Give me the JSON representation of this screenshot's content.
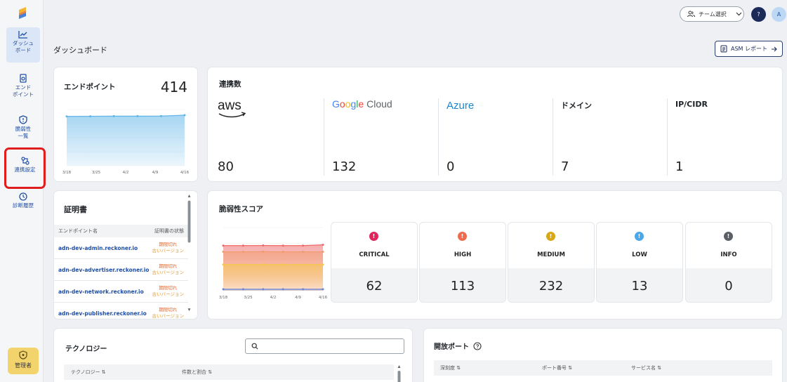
{
  "sidebar": {
    "items": [
      {
        "label_1": "ダッシュ",
        "label_2": "ボード",
        "icon": "chart-line-icon"
      },
      {
        "label_1": "エンド",
        "label_2": "ポイント",
        "icon": "endpoint-icon"
      },
      {
        "label_1": "脆弱性",
        "label_2": "一覧",
        "icon": "shield-icon"
      },
      {
        "label_1": "連携設定",
        "icon": "integration-icon"
      },
      {
        "label_1": "診断履歴",
        "icon": "history-icon"
      }
    ],
    "admin_label": "管理者"
  },
  "header": {
    "team_select": "チーム選択",
    "help": "?",
    "avatar": "A"
  },
  "page": {
    "title": "ダッシュボード",
    "asm_report": "ASM レポート"
  },
  "endpoint": {
    "title": "エンドポイント",
    "count": "414",
    "chart_data": {
      "type": "area",
      "x": [
        "3/18",
        "3/25",
        "4/2",
        "4/9",
        "4/16"
      ],
      "series": [
        {
          "values": [
            404,
            405,
            406,
            406,
            407,
            414
          ]
        }
      ],
      "ylim": [
        0,
        460
      ],
      "color": "#5fb4e8"
    }
  },
  "integrations": {
    "title": "連携数",
    "providers": [
      {
        "name": "aws",
        "value": "80"
      },
      {
        "name": "Google Cloud",
        "value": "132"
      },
      {
        "name": "Azure",
        "value": "0"
      },
      {
        "name": "ドメイン",
        "value": "7"
      },
      {
        "name": "IP/CIDR",
        "value": "1"
      }
    ]
  },
  "certificates": {
    "title": "証明書",
    "col_name": "エンドポイント名",
    "col_status": "証明書の状態",
    "rows": [
      {
        "name": "adn-dev-admin.reckoner.io",
        "status_1": "期限切れ",
        "status_2": "古いバージョン"
      },
      {
        "name": "adn-dev-advertiser.reckoner.io",
        "status_1": "期限切れ",
        "status_2": "古いバージョン"
      },
      {
        "name": "adn-dev-network.reckoner.io",
        "status_1": "期限切れ",
        "status_2": "古いバージョン"
      },
      {
        "name": "adn-dev-publisher.reckoner.io",
        "status_1": "期限切れ",
        "status_2": "古いバージョン"
      }
    ]
  },
  "vulnerability": {
    "title": "脆弱性スコア",
    "chart_data": {
      "type": "area",
      "x": [
        "3/18",
        "3/25",
        "4/2",
        "4/9",
        "4/16"
      ],
      "series": [
        {
          "values": [
            13,
            13,
            13,
            13,
            13,
            13
          ],
          "color": "#6b86d6"
        },
        {
          "values": [
            232,
            232,
            232,
            232,
            232,
            232
          ],
          "color": "#f5c84a"
        },
        {
          "values": [
            345,
            345,
            346,
            345,
            345,
            345
          ],
          "color": "#f29a6b"
        },
        {
          "values": [
            400,
            400,
            401,
            400,
            400,
            407
          ],
          "color": "#ee6a6a"
        }
      ],
      "ylim": [
        0,
        560
      ]
    },
    "severities": [
      {
        "label": "CRITICAL",
        "value": "62",
        "color": "#e0245e"
      },
      {
        "label": "HIGH",
        "value": "113",
        "color": "#ee6b4d"
      },
      {
        "label": "MEDIUM",
        "value": "232",
        "color": "#d9a716"
      },
      {
        "label": "LOW",
        "value": "13",
        "color": "#4aa8e8"
      },
      {
        "label": "INFO",
        "value": "0",
        "color": "#5a5f66"
      }
    ],
    "severity_glyph": "!"
  },
  "technology": {
    "title": "テクノロジー",
    "search_placeholder": "",
    "col_tech": "テクノロジー ⇅",
    "col_count": "件数と割合 ⇅"
  },
  "ports": {
    "title": "開放ポート",
    "col_severity": "深刻度 ⇅",
    "col_port": "ポート番号 ⇅",
    "col_service": "サービス名 ⇅"
  }
}
